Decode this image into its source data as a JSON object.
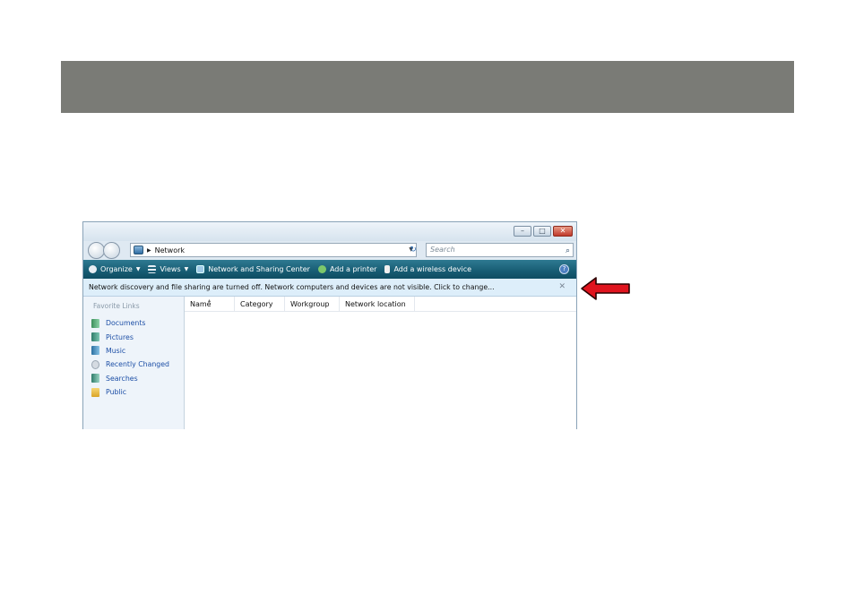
{
  "window": {
    "address": {
      "crumb": "Network"
    },
    "search_placeholder": "Search",
    "toolbar": {
      "items": [
        {
          "label": "Organize",
          "has_dropdown": true,
          "icon": "organize-icon"
        },
        {
          "label": "Views",
          "has_dropdown": true,
          "icon": "views-icon"
        },
        {
          "label": "Network and Sharing Center",
          "has_dropdown": false,
          "icon": "network-center-icon"
        },
        {
          "label": "Add a printer",
          "has_dropdown": false,
          "icon": "printer-icon"
        },
        {
          "label": "Add a wireless device",
          "has_dropdown": false,
          "icon": "wireless-device-icon"
        }
      ]
    },
    "infobar": {
      "message": "Network discovery and file sharing are turned off. Network computers and devices are not visible. Click to change..."
    },
    "nav": {
      "title": "Favorite Links",
      "items": [
        {
          "label": "Documents",
          "icon": "documents-icon"
        },
        {
          "label": "Pictures",
          "icon": "pictures-icon"
        },
        {
          "label": "Music",
          "icon": "music-icon"
        },
        {
          "label": "Recently Changed",
          "icon": "recently-changed-icon"
        },
        {
          "label": "Searches",
          "icon": "searches-icon"
        },
        {
          "label": "Public",
          "icon": "public-folder-icon"
        }
      ]
    },
    "columns": [
      "Name",
      "Category",
      "Workgroup",
      "Network location"
    ]
  },
  "colors": {
    "banner": "#7a7b76",
    "toolbar": "#175c73",
    "infobar": "#ddeefa",
    "link": "#1d4fa6",
    "arrow": "#e0141e"
  }
}
